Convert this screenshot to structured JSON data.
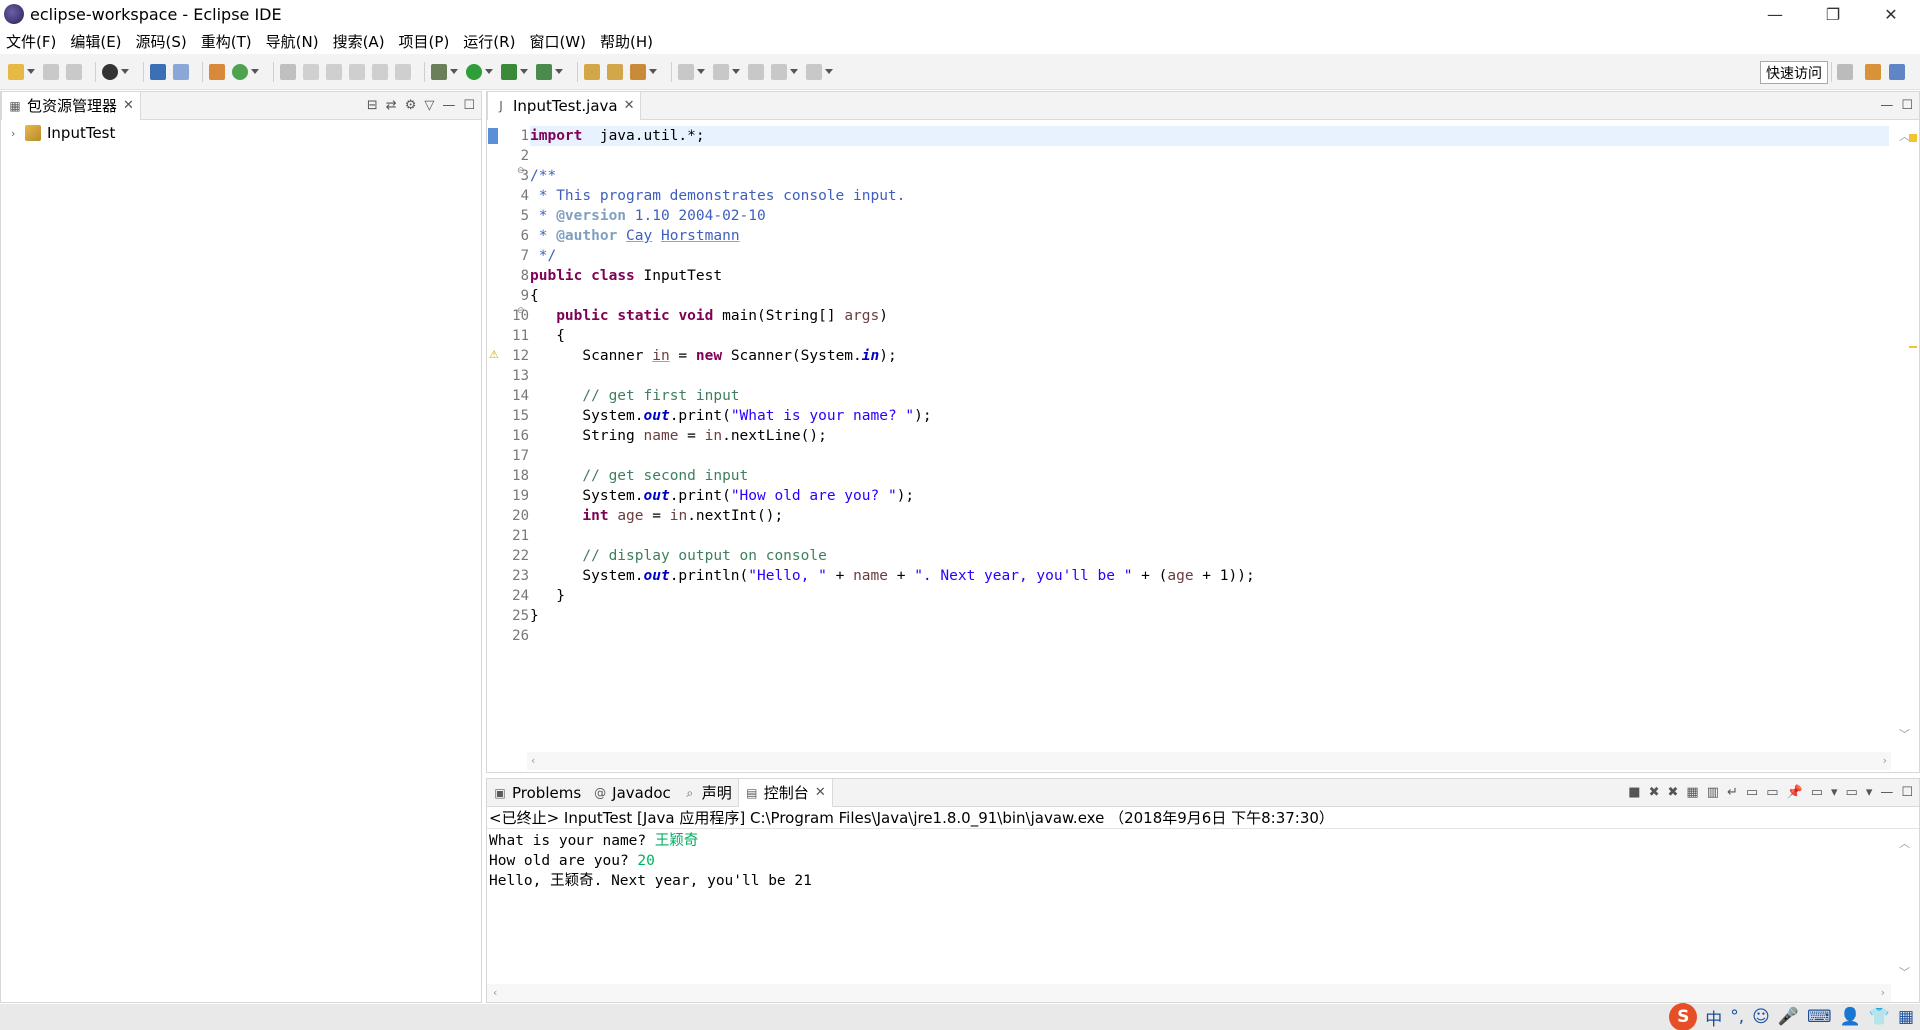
{
  "window": {
    "title": "eclipse-workspace - Eclipse IDE"
  },
  "menu": [
    "文件(F)",
    "编辑(E)",
    "源码(S)",
    "重构(T)",
    "导航(N)",
    "搜索(A)",
    "项目(P)",
    "运行(R)",
    "窗口(W)",
    "帮助(H)"
  ],
  "toolbar": {
    "quick_access": "快速访问"
  },
  "package_explorer": {
    "tab_label": "包资源管理器",
    "items": [
      {
        "label": "InputTest"
      }
    ]
  },
  "editor": {
    "tab_label": "InputTest.java",
    "line_numbers": [
      "1",
      "2",
      "3",
      "4",
      "5",
      "6",
      "7",
      "8",
      "9",
      "10",
      "11",
      "12",
      "13",
      "14",
      "15",
      "16",
      "17",
      "18",
      "19",
      "20",
      "21",
      "22",
      "23",
      "24",
      "25",
      "26"
    ]
  },
  "bottom_tabs": [
    "Problems",
    "Javadoc",
    "声明",
    "控制台"
  ],
  "console": {
    "status": "<已终止> InputTest [Java 应用程序] C:\\Program Files\\Java\\jre1.8.0_91\\bin\\javaw.exe （2018年9月6日 下午8:37:30）",
    "lines": [
      {
        "prompt": "What is your name? ",
        "input": "王颖奇"
      },
      {
        "prompt": "How old are you? ",
        "input": "20"
      },
      {
        "prompt": "Hello, 王颖奇. Next year, you'll be 21",
        "input": ""
      }
    ]
  },
  "ime": {
    "items": [
      "S",
      "中",
      "°,",
      "☺",
      "🎤",
      "⌨",
      "👤",
      "👕",
      "▦"
    ]
  }
}
